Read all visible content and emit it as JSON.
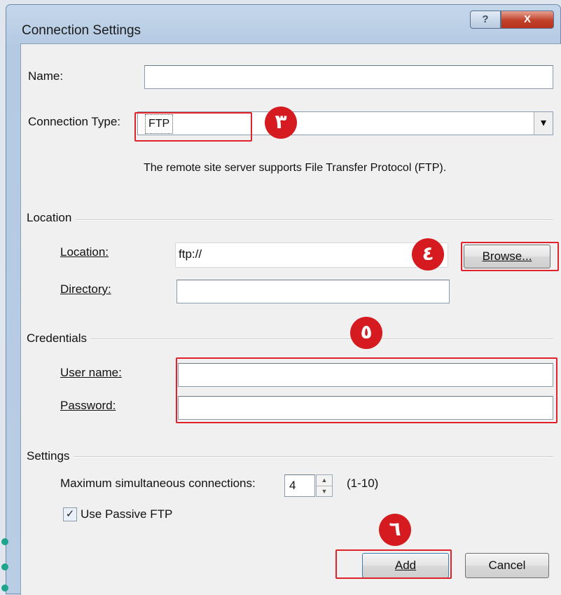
{
  "window": {
    "title": "Connection Settings",
    "help_label": "?",
    "close_label": "X"
  },
  "form": {
    "name_label": "Name:",
    "name_value": "",
    "connection_type_label": "Connection Type:",
    "connection_type_value": "FTP",
    "connection_type_desc": "The remote site server supports File Transfer Protocol (FTP).",
    "dropdown_arrow": "▾"
  },
  "location": {
    "group_title": "Location",
    "location_label": "Location:",
    "location_value": "ftp://",
    "browse_label": "Browse...",
    "directory_label": "Directory:",
    "directory_value": ""
  },
  "credentials": {
    "group_title": "Credentials",
    "username_label": "User name:",
    "username_value": "",
    "password_label": "Password:",
    "password_value": ""
  },
  "settings": {
    "group_title": "Settings",
    "max_conn_label": "Maximum simultaneous connections:",
    "max_conn_value": "4",
    "max_conn_range": "(1-10)",
    "passive_label": "Use Passive FTP",
    "passive_checked": true
  },
  "buttons": {
    "add_label": "Add",
    "cancel_label": "Cancel"
  },
  "annotations": {
    "step3": "٣",
    "step4": "٤",
    "step5": "٥",
    "step6": "٦",
    "highlight_color": "#e0232a"
  }
}
